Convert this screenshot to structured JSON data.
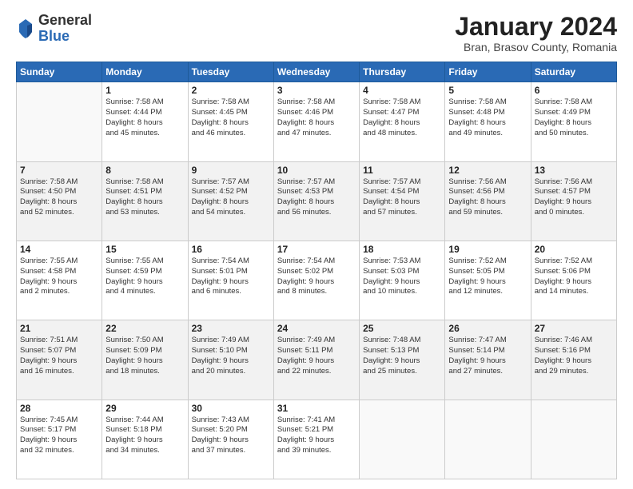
{
  "logo": {
    "general": "General",
    "blue": "Blue"
  },
  "header": {
    "title": "January 2024",
    "location": "Bran, Brasov County, Romania"
  },
  "days_of_week": [
    "Sunday",
    "Monday",
    "Tuesday",
    "Wednesday",
    "Thursday",
    "Friday",
    "Saturday"
  ],
  "weeks": [
    [
      {
        "day": "",
        "info": ""
      },
      {
        "day": "1",
        "info": "Sunrise: 7:58 AM\nSunset: 4:44 PM\nDaylight: 8 hours\nand 45 minutes."
      },
      {
        "day": "2",
        "info": "Sunrise: 7:58 AM\nSunset: 4:45 PM\nDaylight: 8 hours\nand 46 minutes."
      },
      {
        "day": "3",
        "info": "Sunrise: 7:58 AM\nSunset: 4:46 PM\nDaylight: 8 hours\nand 47 minutes."
      },
      {
        "day": "4",
        "info": "Sunrise: 7:58 AM\nSunset: 4:47 PM\nDaylight: 8 hours\nand 48 minutes."
      },
      {
        "day": "5",
        "info": "Sunrise: 7:58 AM\nSunset: 4:48 PM\nDaylight: 8 hours\nand 49 minutes."
      },
      {
        "day": "6",
        "info": "Sunrise: 7:58 AM\nSunset: 4:49 PM\nDaylight: 8 hours\nand 50 minutes."
      }
    ],
    [
      {
        "day": "7",
        "info": "Sunrise: 7:58 AM\nSunset: 4:50 PM\nDaylight: 8 hours\nand 52 minutes."
      },
      {
        "day": "8",
        "info": "Sunrise: 7:58 AM\nSunset: 4:51 PM\nDaylight: 8 hours\nand 53 minutes."
      },
      {
        "day": "9",
        "info": "Sunrise: 7:57 AM\nSunset: 4:52 PM\nDaylight: 8 hours\nand 54 minutes."
      },
      {
        "day": "10",
        "info": "Sunrise: 7:57 AM\nSunset: 4:53 PM\nDaylight: 8 hours\nand 56 minutes."
      },
      {
        "day": "11",
        "info": "Sunrise: 7:57 AM\nSunset: 4:54 PM\nDaylight: 8 hours\nand 57 minutes."
      },
      {
        "day": "12",
        "info": "Sunrise: 7:56 AM\nSunset: 4:56 PM\nDaylight: 8 hours\nand 59 minutes."
      },
      {
        "day": "13",
        "info": "Sunrise: 7:56 AM\nSunset: 4:57 PM\nDaylight: 9 hours\nand 0 minutes."
      }
    ],
    [
      {
        "day": "14",
        "info": "Sunrise: 7:55 AM\nSunset: 4:58 PM\nDaylight: 9 hours\nand 2 minutes."
      },
      {
        "day": "15",
        "info": "Sunrise: 7:55 AM\nSunset: 4:59 PM\nDaylight: 9 hours\nand 4 minutes."
      },
      {
        "day": "16",
        "info": "Sunrise: 7:54 AM\nSunset: 5:01 PM\nDaylight: 9 hours\nand 6 minutes."
      },
      {
        "day": "17",
        "info": "Sunrise: 7:54 AM\nSunset: 5:02 PM\nDaylight: 9 hours\nand 8 minutes."
      },
      {
        "day": "18",
        "info": "Sunrise: 7:53 AM\nSunset: 5:03 PM\nDaylight: 9 hours\nand 10 minutes."
      },
      {
        "day": "19",
        "info": "Sunrise: 7:52 AM\nSunset: 5:05 PM\nDaylight: 9 hours\nand 12 minutes."
      },
      {
        "day": "20",
        "info": "Sunrise: 7:52 AM\nSunset: 5:06 PM\nDaylight: 9 hours\nand 14 minutes."
      }
    ],
    [
      {
        "day": "21",
        "info": "Sunrise: 7:51 AM\nSunset: 5:07 PM\nDaylight: 9 hours\nand 16 minutes."
      },
      {
        "day": "22",
        "info": "Sunrise: 7:50 AM\nSunset: 5:09 PM\nDaylight: 9 hours\nand 18 minutes."
      },
      {
        "day": "23",
        "info": "Sunrise: 7:49 AM\nSunset: 5:10 PM\nDaylight: 9 hours\nand 20 minutes."
      },
      {
        "day": "24",
        "info": "Sunrise: 7:49 AM\nSunset: 5:11 PM\nDaylight: 9 hours\nand 22 minutes."
      },
      {
        "day": "25",
        "info": "Sunrise: 7:48 AM\nSunset: 5:13 PM\nDaylight: 9 hours\nand 25 minutes."
      },
      {
        "day": "26",
        "info": "Sunrise: 7:47 AM\nSunset: 5:14 PM\nDaylight: 9 hours\nand 27 minutes."
      },
      {
        "day": "27",
        "info": "Sunrise: 7:46 AM\nSunset: 5:16 PM\nDaylight: 9 hours\nand 29 minutes."
      }
    ],
    [
      {
        "day": "28",
        "info": "Sunrise: 7:45 AM\nSunset: 5:17 PM\nDaylight: 9 hours\nand 32 minutes."
      },
      {
        "day": "29",
        "info": "Sunrise: 7:44 AM\nSunset: 5:18 PM\nDaylight: 9 hours\nand 34 minutes."
      },
      {
        "day": "30",
        "info": "Sunrise: 7:43 AM\nSunset: 5:20 PM\nDaylight: 9 hours\nand 37 minutes."
      },
      {
        "day": "31",
        "info": "Sunrise: 7:41 AM\nSunset: 5:21 PM\nDaylight: 9 hours\nand 39 minutes."
      },
      {
        "day": "",
        "info": ""
      },
      {
        "day": "",
        "info": ""
      },
      {
        "day": "",
        "info": ""
      }
    ]
  ]
}
